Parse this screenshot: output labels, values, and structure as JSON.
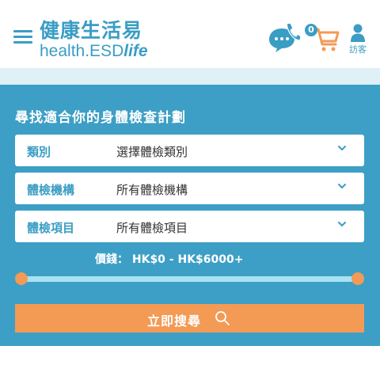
{
  "header": {
    "menu_icon": "hamburger-menu-icon",
    "logo_cn": "健康生活易",
    "logo_en_main": "health.ESD",
    "logo_en_life": "life",
    "hotline_icon": "phone-chat-icon",
    "cart_icon": "shopping-cart-icon",
    "cart_count": "0",
    "guest_icon": "user-icon",
    "guest_label": "訪客",
    "brand_color": "#3a9dc4"
  },
  "search_panel": {
    "title": "尋找適合你的身體檢查計劃",
    "fields": [
      {
        "label": "類別",
        "value": "選擇體檢類別"
      },
      {
        "label": "體檢機構",
        "value": "所有體檢機構"
      },
      {
        "label": "體檢項目",
        "value": "所有體檢項目"
      }
    ],
    "price_label": "價錢：",
    "price_range": "HK$0 - HK$6000+",
    "slider": {
      "min": 0,
      "max": 6000,
      "low": 0,
      "high": 6000
    },
    "search_button": "立即搜尋",
    "panel_color": "#3d9fc5",
    "accent_color": "#f39a55"
  }
}
